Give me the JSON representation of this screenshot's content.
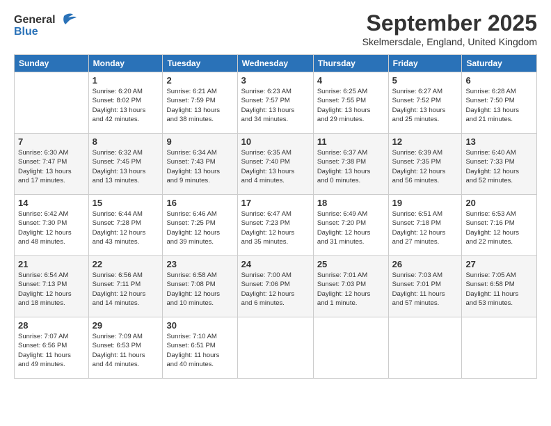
{
  "header": {
    "logo_line1": "General",
    "logo_line2": "Blue",
    "month": "September 2025",
    "location": "Skelmersdale, England, United Kingdom"
  },
  "weekdays": [
    "Sunday",
    "Monday",
    "Tuesday",
    "Wednesday",
    "Thursday",
    "Friday",
    "Saturday"
  ],
  "weeks": [
    [
      {
        "day": "",
        "info": ""
      },
      {
        "day": "1",
        "info": "Sunrise: 6:20 AM\nSunset: 8:02 PM\nDaylight: 13 hours\nand 42 minutes."
      },
      {
        "day": "2",
        "info": "Sunrise: 6:21 AM\nSunset: 7:59 PM\nDaylight: 13 hours\nand 38 minutes."
      },
      {
        "day": "3",
        "info": "Sunrise: 6:23 AM\nSunset: 7:57 PM\nDaylight: 13 hours\nand 34 minutes."
      },
      {
        "day": "4",
        "info": "Sunrise: 6:25 AM\nSunset: 7:55 PM\nDaylight: 13 hours\nand 29 minutes."
      },
      {
        "day": "5",
        "info": "Sunrise: 6:27 AM\nSunset: 7:52 PM\nDaylight: 13 hours\nand 25 minutes."
      },
      {
        "day": "6",
        "info": "Sunrise: 6:28 AM\nSunset: 7:50 PM\nDaylight: 13 hours\nand 21 minutes."
      }
    ],
    [
      {
        "day": "7",
        "info": "Sunrise: 6:30 AM\nSunset: 7:47 PM\nDaylight: 13 hours\nand 17 minutes."
      },
      {
        "day": "8",
        "info": "Sunrise: 6:32 AM\nSunset: 7:45 PM\nDaylight: 13 hours\nand 13 minutes."
      },
      {
        "day": "9",
        "info": "Sunrise: 6:34 AM\nSunset: 7:43 PM\nDaylight: 13 hours\nand 9 minutes."
      },
      {
        "day": "10",
        "info": "Sunrise: 6:35 AM\nSunset: 7:40 PM\nDaylight: 13 hours\nand 4 minutes."
      },
      {
        "day": "11",
        "info": "Sunrise: 6:37 AM\nSunset: 7:38 PM\nDaylight: 13 hours\nand 0 minutes."
      },
      {
        "day": "12",
        "info": "Sunrise: 6:39 AM\nSunset: 7:35 PM\nDaylight: 12 hours\nand 56 minutes."
      },
      {
        "day": "13",
        "info": "Sunrise: 6:40 AM\nSunset: 7:33 PM\nDaylight: 12 hours\nand 52 minutes."
      }
    ],
    [
      {
        "day": "14",
        "info": "Sunrise: 6:42 AM\nSunset: 7:30 PM\nDaylight: 12 hours\nand 48 minutes."
      },
      {
        "day": "15",
        "info": "Sunrise: 6:44 AM\nSunset: 7:28 PM\nDaylight: 12 hours\nand 43 minutes."
      },
      {
        "day": "16",
        "info": "Sunrise: 6:46 AM\nSunset: 7:25 PM\nDaylight: 12 hours\nand 39 minutes."
      },
      {
        "day": "17",
        "info": "Sunrise: 6:47 AM\nSunset: 7:23 PM\nDaylight: 12 hours\nand 35 minutes."
      },
      {
        "day": "18",
        "info": "Sunrise: 6:49 AM\nSunset: 7:20 PM\nDaylight: 12 hours\nand 31 minutes."
      },
      {
        "day": "19",
        "info": "Sunrise: 6:51 AM\nSunset: 7:18 PM\nDaylight: 12 hours\nand 27 minutes."
      },
      {
        "day": "20",
        "info": "Sunrise: 6:53 AM\nSunset: 7:16 PM\nDaylight: 12 hours\nand 22 minutes."
      }
    ],
    [
      {
        "day": "21",
        "info": "Sunrise: 6:54 AM\nSunset: 7:13 PM\nDaylight: 12 hours\nand 18 minutes."
      },
      {
        "day": "22",
        "info": "Sunrise: 6:56 AM\nSunset: 7:11 PM\nDaylight: 12 hours\nand 14 minutes."
      },
      {
        "day": "23",
        "info": "Sunrise: 6:58 AM\nSunset: 7:08 PM\nDaylight: 12 hours\nand 10 minutes."
      },
      {
        "day": "24",
        "info": "Sunrise: 7:00 AM\nSunset: 7:06 PM\nDaylight: 12 hours\nand 6 minutes."
      },
      {
        "day": "25",
        "info": "Sunrise: 7:01 AM\nSunset: 7:03 PM\nDaylight: 12 hours\nand 1 minute."
      },
      {
        "day": "26",
        "info": "Sunrise: 7:03 AM\nSunset: 7:01 PM\nDaylight: 11 hours\nand 57 minutes."
      },
      {
        "day": "27",
        "info": "Sunrise: 7:05 AM\nSunset: 6:58 PM\nDaylight: 11 hours\nand 53 minutes."
      }
    ],
    [
      {
        "day": "28",
        "info": "Sunrise: 7:07 AM\nSunset: 6:56 PM\nDaylight: 11 hours\nand 49 minutes."
      },
      {
        "day": "29",
        "info": "Sunrise: 7:09 AM\nSunset: 6:53 PM\nDaylight: 11 hours\nand 44 minutes."
      },
      {
        "day": "30",
        "info": "Sunrise: 7:10 AM\nSunset: 6:51 PM\nDaylight: 11 hours\nand 40 minutes."
      },
      {
        "day": "",
        "info": ""
      },
      {
        "day": "",
        "info": ""
      },
      {
        "day": "",
        "info": ""
      },
      {
        "day": "",
        "info": ""
      }
    ]
  ]
}
